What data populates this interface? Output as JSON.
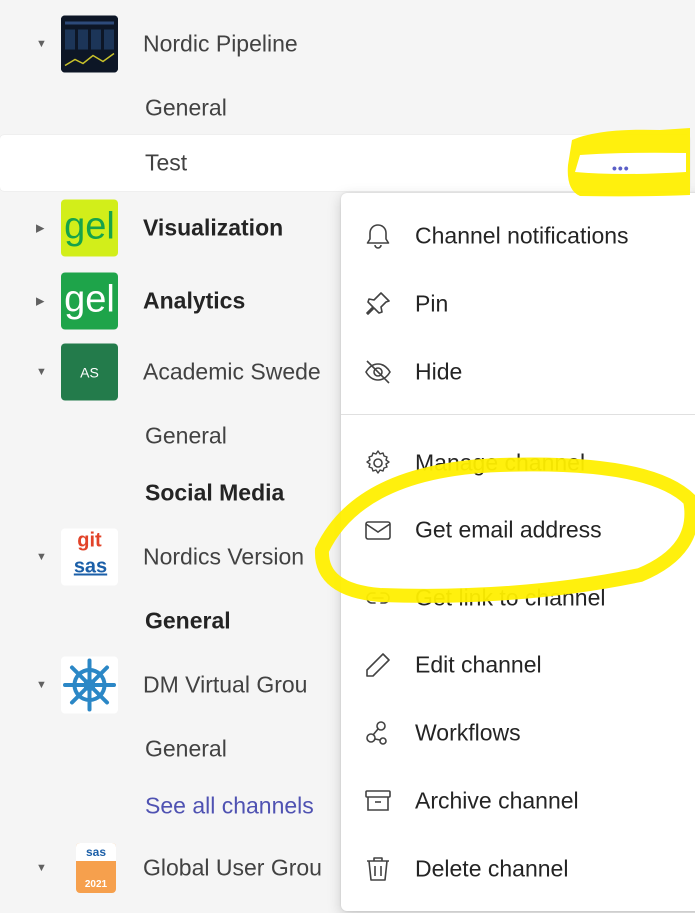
{
  "teams": [
    {
      "name": "Nordic Pipeline",
      "bold": false,
      "avatar": "nordic-pipeline"
    },
    {
      "name": "Visualization",
      "bold": true,
      "avatar": "gel"
    },
    {
      "name": "Analytics",
      "bold": true,
      "avatar": "gel"
    },
    {
      "name": "Academic Swede",
      "bold": false,
      "avatar": "AS"
    },
    {
      "name": "Nordics Version",
      "bold": false,
      "avatar": "git-sas"
    },
    {
      "name": "DM Virtual Grou",
      "bold": false,
      "avatar": "dm-wheel"
    },
    {
      "name": "Global User Grou",
      "bold": false,
      "avatar": "sas-users"
    }
  ],
  "avatars": {
    "gel": "gel",
    "AS": "AS",
    "git": "git",
    "sas": "sas",
    "sas_users_top": "sas",
    "sas_users_year": "2021"
  },
  "channels": {
    "nordic_general": "General",
    "nordic_test": "Test",
    "academic_general": "General",
    "academic_social": "Social Media",
    "nordics_general": "General",
    "dm_general": "General",
    "dm_see_all": "See all channels"
  },
  "more_button": "•••",
  "context_menu": {
    "items": [
      {
        "label": "Channel notifications",
        "icon": "bell-icon"
      },
      {
        "label": "Pin",
        "icon": "pin-icon"
      },
      {
        "label": "Hide",
        "icon": "eye-off-icon"
      },
      {
        "label": "Manage channel",
        "icon": "gear-icon"
      },
      {
        "label": "Get email address",
        "icon": "mail-icon"
      },
      {
        "label": "Get link to channel",
        "icon": "link-icon"
      },
      {
        "label": "Edit channel",
        "icon": "pencil-icon"
      },
      {
        "label": "Workflows",
        "icon": "workflow-icon"
      },
      {
        "label": "Archive channel",
        "icon": "archive-icon"
      },
      {
        "label": "Delete channel",
        "icon": "trash-icon"
      }
    ]
  },
  "colors": {
    "highlight": "#ffef00",
    "accent": "#5b5fc7",
    "gel_bg": "#d2ee1a",
    "gel_bg2": "#1ea44a",
    "as_bg": "#237b4b"
  }
}
